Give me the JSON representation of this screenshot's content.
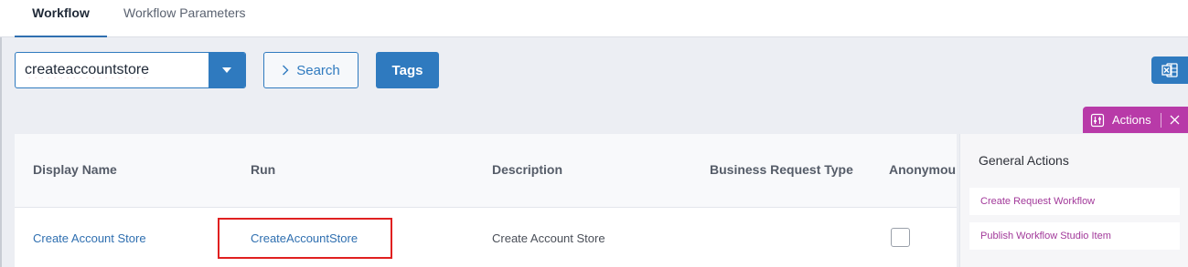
{
  "tabs": [
    {
      "label": "Workflow",
      "active": true
    },
    {
      "label": "Workflow Parameters",
      "active": false
    }
  ],
  "filter": {
    "value": "createaccountstore",
    "search_label": "Search",
    "tags_label": "Tags"
  },
  "export": {
    "icon": "excel-icon"
  },
  "actions_tab": {
    "label": "Actions"
  },
  "table": {
    "columns": [
      "Display Name",
      "Run",
      "Description",
      "Business Request Type",
      "Anonymou"
    ],
    "rows": [
      {
        "display_name": "Create Account Store",
        "run": "CreateAccountStore",
        "description": "Create Account Store",
        "business_request_type": "",
        "anonymous": false
      }
    ]
  },
  "panel": {
    "title": "General Actions",
    "items": [
      "Create Request Workflow",
      "Publish Workflow Studio Item"
    ]
  },
  "colors": {
    "primary": "#2f7abf",
    "actions_accent": "#b83aa8",
    "highlight_border": "#e02020"
  }
}
